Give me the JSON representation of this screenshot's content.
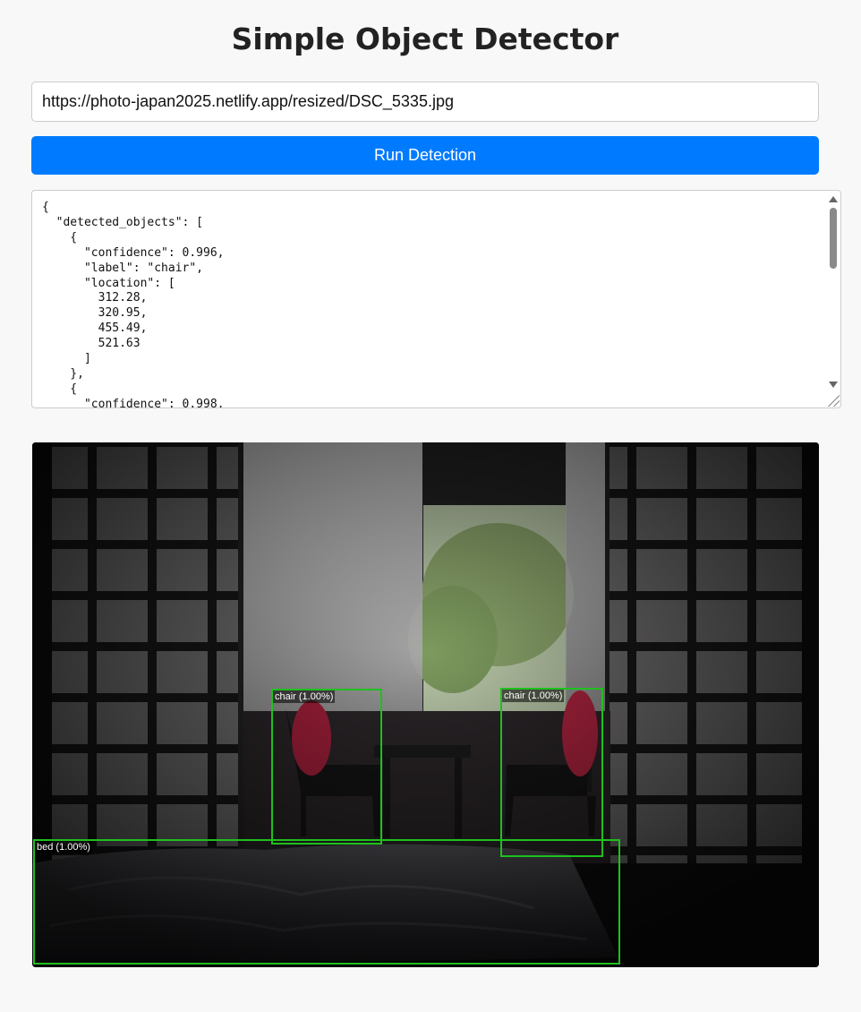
{
  "page": {
    "title": "Simple Object Detector"
  },
  "form": {
    "image_url": "https://photo-japan2025.netlify.app/resized/DSC_5335.jpg",
    "run_button_label": "Run Detection"
  },
  "results": {
    "json_text": "{\n  \"detected_objects\": [\n    {\n      \"confidence\": 0.996,\n      \"label\": \"chair\",\n      \"location\": [\n        312.28,\n        320.95,\n        455.49,\n        521.63\n      ]\n    },\n    {\n      \"confidence\": 0.998,"
  },
  "detections": [
    {
      "label": "chair (1.00%)",
      "color": "#1ec01e"
    },
    {
      "label": "chair (1.00%)",
      "color": "#1ec01e"
    },
    {
      "label": "bed (1.00%)",
      "color": "#1ec01e"
    }
  ]
}
